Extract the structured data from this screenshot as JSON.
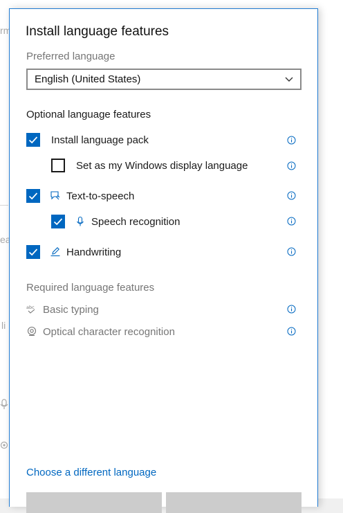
{
  "background": {
    "fragments": [
      "rm",
      "ea",
      "li"
    ]
  },
  "dialog": {
    "title": "Install language features",
    "preferred_language_label": "Preferred language",
    "preferred_language_value": "English (United States)",
    "optional_heading": "Optional language features",
    "optional_features": [
      {
        "label": "Install language pack",
        "checked": true,
        "icon": null
      },
      {
        "label": "Set as my Windows display language",
        "checked": false,
        "icon": null
      },
      {
        "label": "Text-to-speech",
        "checked": true,
        "icon": "speech-bubble-icon"
      },
      {
        "label": "Speech recognition",
        "checked": true,
        "icon": "microphone-icon"
      },
      {
        "label": "Handwriting",
        "checked": true,
        "icon": "pen-icon"
      }
    ],
    "required_heading": "Required language features",
    "required_features": [
      {
        "label": "Basic typing",
        "icon": "abc-check-icon"
      },
      {
        "label": "Optical character recognition",
        "icon": "eye-scan-icon"
      }
    ],
    "choose_link": "Choose a different language"
  },
  "colors": {
    "accent": "#0067c0",
    "border": "#1f7ad1",
    "muted_text": "#767676"
  }
}
